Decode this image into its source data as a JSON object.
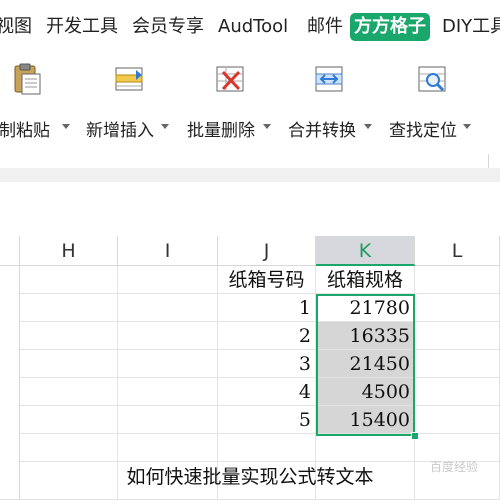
{
  "tabs": [
    "视图",
    "开发工具",
    "会员专享",
    "AudTool",
    "邮件",
    "方方格子",
    "DIY工具"
  ],
  "active_tab": "方方格子",
  "ribbon": {
    "buttons": [
      {
        "label": "复制粘贴",
        "icon": "clipboard-paste-icon"
      },
      {
        "label": "新增插入",
        "icon": "insert-row-icon"
      },
      {
        "label": "批量删除",
        "icon": "batch-delete-icon"
      },
      {
        "label": "合并转换",
        "icon": "merge-convert-icon"
      },
      {
        "label": "查找定位",
        "icon": "find-locate-icon"
      }
    ]
  },
  "columns": [
    "H",
    "I",
    "J",
    "K",
    "L"
  ],
  "selected_column": "K",
  "table": {
    "header_j": "纸箱号码",
    "header_k": "纸箱规格",
    "rows": [
      {
        "j": "1",
        "k": "21780"
      },
      {
        "j": "2",
        "k": "16335"
      },
      {
        "j": "3",
        "k": "21450"
      },
      {
        "j": "4",
        "k": "4500"
      },
      {
        "j": "5",
        "k": "15400"
      }
    ]
  },
  "caption": "如何快速批量实现公式转文本",
  "watermark": "百度经验",
  "colors": {
    "accent": "#1aa76b",
    "selected_header_bg": "#d7d8dd",
    "selected_cell_bg": "#d6d6d6"
  }
}
